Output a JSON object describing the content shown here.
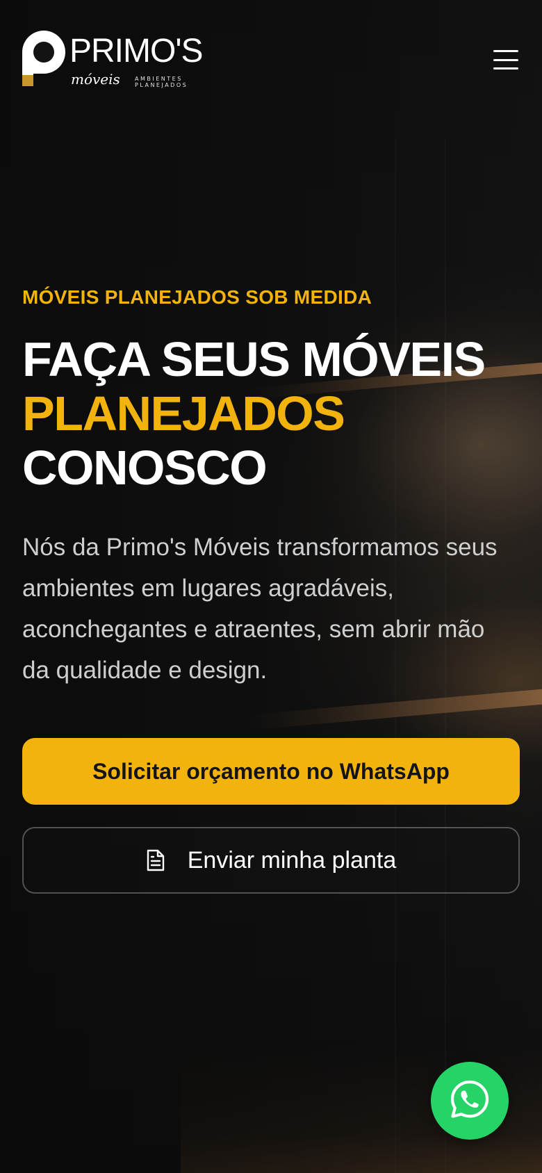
{
  "brand": {
    "name": "PRIMO'S",
    "sub": "móveis",
    "tagline": "AMBIENTES PLANEJADOS",
    "accent_color": "#f2b30c",
    "mark_square_color": "#c9962b"
  },
  "header": {
    "menu_icon": "hamburger-menu-icon"
  },
  "hero": {
    "eyebrow": "MÓVEIS PLANEJADOS SOB MEDIDA",
    "title_line1": "FAÇA SEUS MÓVEIS",
    "title_line2": "PLANEJADOS",
    "title_line3": "CONOSCO",
    "description": "Nós da Primo's Móveis transformamos seus ambientes em lugares agradáveis, aconchegantes e atraentes, sem abrir mão da qualidade e design."
  },
  "actions": {
    "primary_label": "Solicitar orçamento no WhatsApp",
    "secondary_label": "Enviar minha planta",
    "secondary_icon": "document-icon",
    "primary_color": "#f2b30c"
  },
  "fab": {
    "icon": "whatsapp-icon",
    "color": "#25d366"
  }
}
